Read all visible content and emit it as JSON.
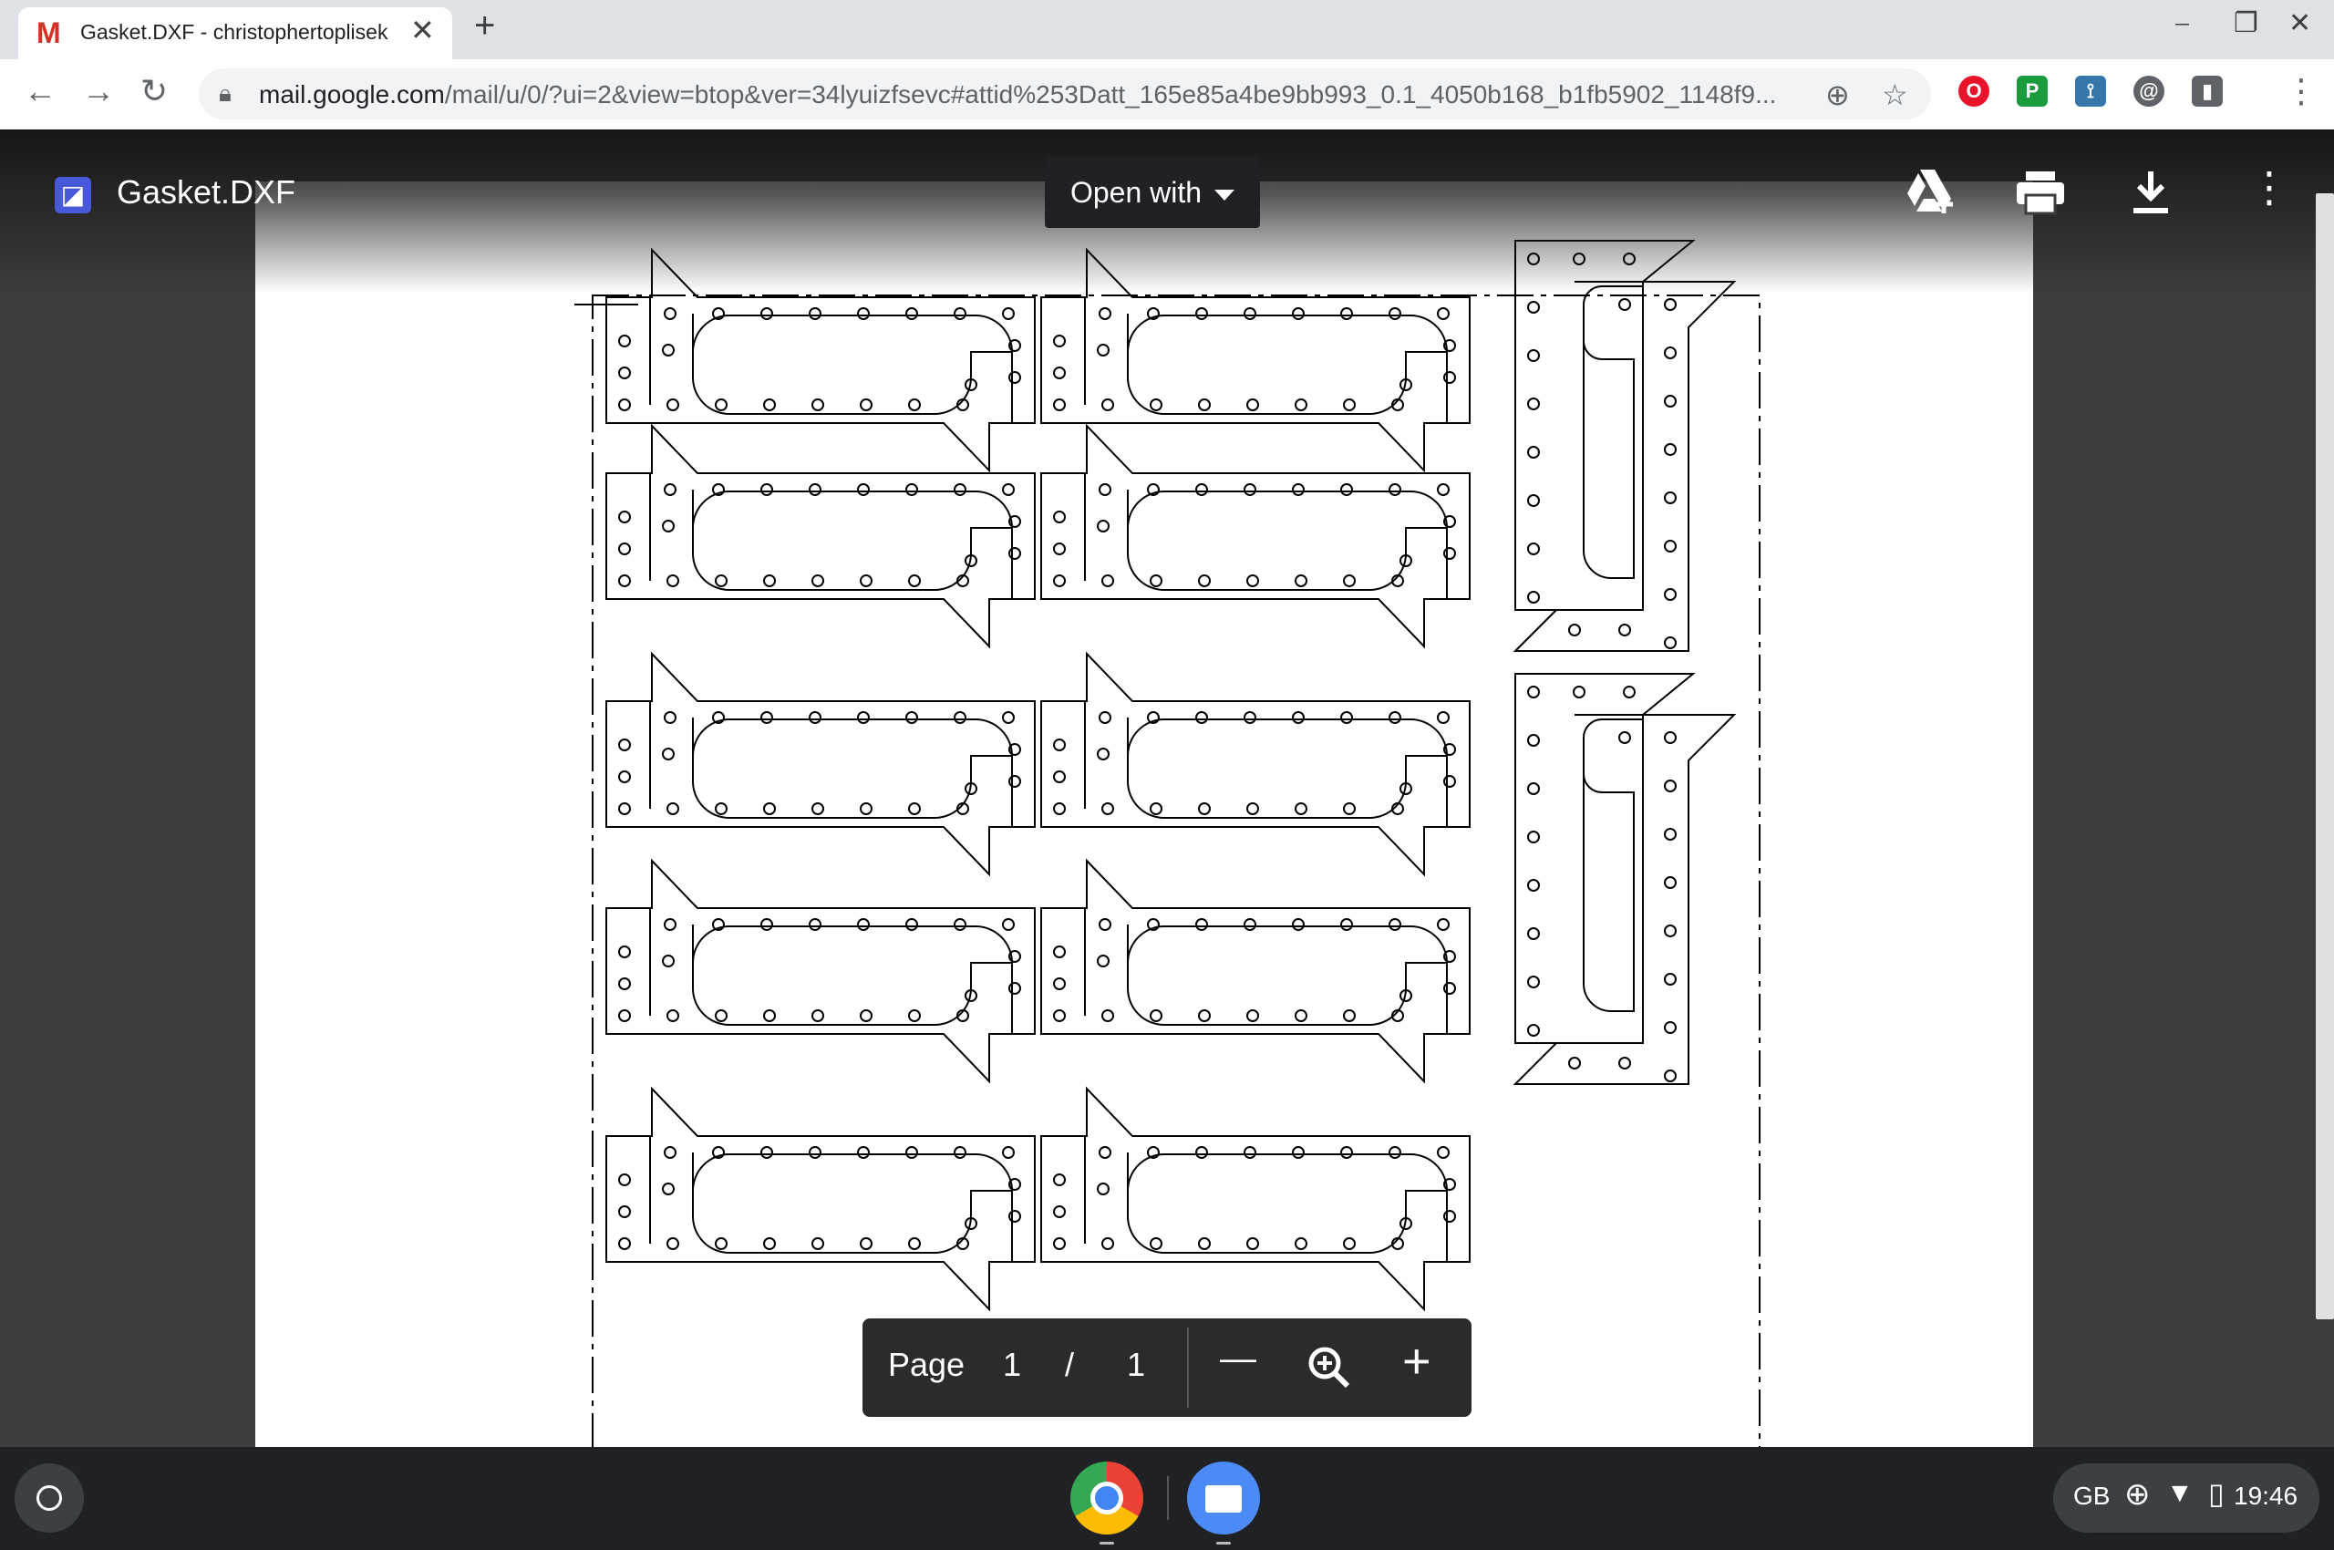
{
  "tab": {
    "favicon": "M",
    "title": "Gasket.DXF - christophertoplisek",
    "close": "✕",
    "new_tab": "+"
  },
  "window_controls": {
    "minimize": "⎯",
    "restore": "❐",
    "close": "✕"
  },
  "toolbar": {
    "back": "←",
    "forward": "→",
    "reload": "↻",
    "url_host": "mail.google.com",
    "url_path": "/mail/u/0/?ui=2&view=btop&ver=34lyuizfsevc#attid%253Datt_165e85a4be9bb993_0.1_4050b168_b1fb5902_1148f9...",
    "zoom_icon": "⊕",
    "star_icon": "☆",
    "menu_icon": "⋮"
  },
  "viewer": {
    "file_name": "Gasket.DXF",
    "open_with_label": "Open with",
    "add_to_drive_icon": "drive-add-icon",
    "print_icon": "printer-icon",
    "download_icon": "download-icon",
    "more_icon": "⋮"
  },
  "page_control": {
    "label": "Page",
    "current": "1",
    "separator": "/",
    "total": "1",
    "zoom_out": "—",
    "zoom_in": "+"
  },
  "shelf": {
    "keyboard_layout": "GB",
    "time": "19:46"
  },
  "colors": {
    "accent_blue": "#4285f4",
    "gmail_red": "#d93025",
    "drawing_stroke": "#000000"
  }
}
